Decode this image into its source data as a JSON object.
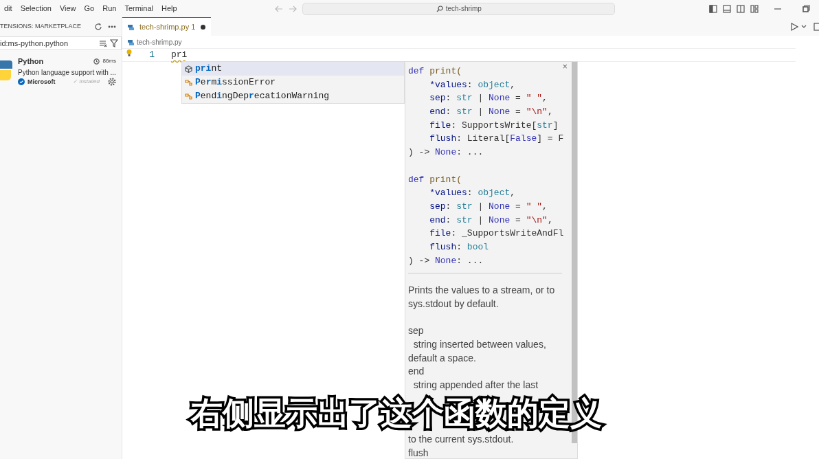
{
  "menu": [
    "dit",
    "Selection",
    "View",
    "Go",
    "Run",
    "Terminal",
    "Help"
  ],
  "command_center": {
    "value": "tech-shrimp"
  },
  "sidebar": {
    "title": "TENSIONS: MARKETPLACE",
    "search": {
      "value": "id:ms-python.python"
    },
    "extensions": [
      {
        "name": "Python",
        "time": "86ms",
        "description": "Python language support with ...",
        "publisher": "Microsoft",
        "status": "✓ Installed"
      }
    ]
  },
  "tabs": [
    {
      "label": "tech-shrimp.py",
      "problems": "1",
      "modified": true,
      "selected": true
    }
  ],
  "breadcrumb": "tech-shrimp.py",
  "editor": {
    "line_number": "1",
    "code": "pri"
  },
  "suggestions": [
    {
      "kind": "function",
      "selected": true,
      "parts": [
        {
          "text": "pri",
          "hl": true
        },
        {
          "text": "nt",
          "hl": false
        }
      ]
    },
    {
      "kind": "class",
      "selected": false,
      "parts": [
        {
          "text": "P",
          "hl": true
        },
        {
          "text": "e",
          "hl": false
        },
        {
          "text": "r",
          "hl": true
        },
        {
          "text": "m",
          "hl": false
        },
        {
          "text": "i",
          "hl": true
        },
        {
          "text": "ssionError",
          "hl": false
        }
      ]
    },
    {
      "kind": "class",
      "selected": false,
      "parts": [
        {
          "text": "P",
          "hl": true
        },
        {
          "text": "end",
          "hl": false
        },
        {
          "text": "i",
          "hl": true
        },
        {
          "text": "ngDep",
          "hl": false
        },
        {
          "text": "r",
          "hl": true
        },
        {
          "text": "ecationWarning",
          "hl": false
        }
      ]
    }
  ],
  "hover": {
    "close": "×",
    "signatures": [
      [
        [
          {
            "t": "def ",
            "kind": "kw"
          },
          {
            "t": "print(",
            "kind": "fn"
          }
        ],
        [
          {
            "t": "    *values",
            "kind": "par"
          },
          {
            "t": ": ",
            "kind": "p"
          },
          {
            "t": "object",
            "kind": "ty"
          },
          {
            "t": ",",
            "kind": "p"
          }
        ],
        [
          {
            "t": "    sep",
            "kind": "par"
          },
          {
            "t": ": ",
            "kind": "p"
          },
          {
            "t": "str",
            "kind": "ty"
          },
          {
            "t": " | ",
            "kind": "p"
          },
          {
            "t": "None",
            "kind": "kw"
          },
          {
            "t": " = ",
            "kind": "p"
          },
          {
            "t": "\" \"",
            "kind": "str"
          },
          {
            "t": ",",
            "kind": "p"
          }
        ],
        [
          {
            "t": "    end",
            "kind": "par"
          },
          {
            "t": ": ",
            "kind": "p"
          },
          {
            "t": "str",
            "kind": "ty"
          },
          {
            "t": " | ",
            "kind": "p"
          },
          {
            "t": "None",
            "kind": "kw"
          },
          {
            "t": " = ",
            "kind": "p"
          },
          {
            "t": "\"\\n\"",
            "kind": "str"
          },
          {
            "t": ",",
            "kind": "p"
          }
        ],
        [
          {
            "t": "    file",
            "kind": "par"
          },
          {
            "t": ": SupportsWrite[",
            "kind": "p"
          },
          {
            "t": "str",
            "kind": "ty"
          },
          {
            "t": "]",
            "kind": "p"
          }
        ],
        [
          {
            "t": "    flush",
            "kind": "par"
          },
          {
            "t": ": Literal[",
            "kind": "p"
          },
          {
            "t": "False",
            "kind": "kw"
          },
          {
            "t": "] = F",
            "kind": "p"
          }
        ],
        [
          {
            "t": ") -> ",
            "kind": "p"
          },
          {
            "t": "None",
            "kind": "kw"
          },
          {
            "t": ": ...",
            "kind": "p"
          }
        ]
      ],
      [
        [
          {
            "t": "def ",
            "kind": "kw"
          },
          {
            "t": "print(",
            "kind": "fn"
          }
        ],
        [
          {
            "t": "    *values",
            "kind": "par"
          },
          {
            "t": ": ",
            "kind": "p"
          },
          {
            "t": "object",
            "kind": "ty"
          },
          {
            "t": ",",
            "kind": "p"
          }
        ],
        [
          {
            "t": "    sep",
            "kind": "par"
          },
          {
            "t": ": ",
            "kind": "p"
          },
          {
            "t": "str",
            "kind": "ty"
          },
          {
            "t": " | ",
            "kind": "p"
          },
          {
            "t": "None",
            "kind": "kw"
          },
          {
            "t": " = ",
            "kind": "p"
          },
          {
            "t": "\" \"",
            "kind": "str"
          },
          {
            "t": ",",
            "kind": "p"
          }
        ],
        [
          {
            "t": "    end",
            "kind": "par"
          },
          {
            "t": ": ",
            "kind": "p"
          },
          {
            "t": "str",
            "kind": "ty"
          },
          {
            "t": " | ",
            "kind": "p"
          },
          {
            "t": "None",
            "kind": "kw"
          },
          {
            "t": " = ",
            "kind": "p"
          },
          {
            "t": "\"\\n\"",
            "kind": "str"
          },
          {
            "t": ",",
            "kind": "p"
          }
        ],
        [
          {
            "t": "    file",
            "kind": "par"
          },
          {
            "t": ": _SupportsWriteAndFl",
            "kind": "p"
          }
        ],
        [
          {
            "t": "    flush",
            "kind": "par"
          },
          {
            "t": ": ",
            "kind": "p"
          },
          {
            "t": "bool",
            "kind": "ty"
          }
        ],
        [
          {
            "t": ") -> ",
            "kind": "p"
          },
          {
            "t": "None",
            "kind": "kw"
          },
          {
            "t": ": ...",
            "kind": "p"
          }
        ]
      ]
    ],
    "doc": [
      {
        "kind": "text",
        "text": "Prints the values to a stream, or to"
      },
      {
        "kind": "text",
        "text": "sys.stdout by default."
      },
      {
        "kind": "blank"
      },
      {
        "kind": "text",
        "text": "sep"
      },
      {
        "kind": "text",
        "text": "  string inserted between values,"
      },
      {
        "kind": "text",
        "text": "default a space."
      },
      {
        "kind": "text",
        "text": "end"
      },
      {
        "kind": "text",
        "text": "  string appended after the last"
      },
      {
        "kind": "covered"
      },
      {
        "kind": "covered"
      },
      {
        "kind": "covered"
      },
      {
        "kind": "text",
        "text": "to the current sys.stdout."
      },
      {
        "kind": "text",
        "text": "flush"
      }
    ]
  },
  "subtitle": "右侧显示出了这个函数的定义"
}
